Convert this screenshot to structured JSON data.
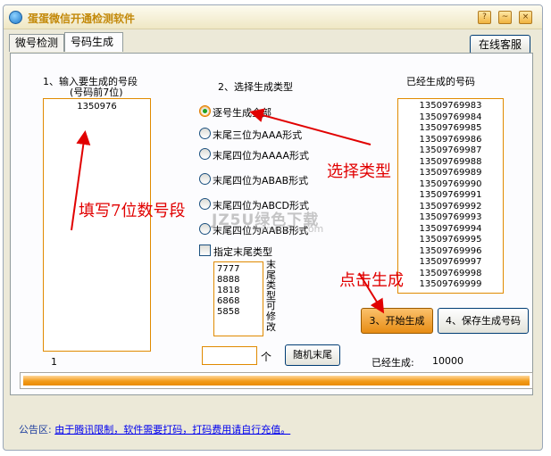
{
  "window": {
    "title": "蛋蛋微信开通检测软件",
    "title_color": "#c3890a",
    "buttons": [
      "?",
      "~",
      "×"
    ]
  },
  "tabs": [
    {
      "label": "微号检测",
      "active": false
    },
    {
      "label": "号码生成",
      "active": true
    }
  ],
  "online_service_label": "在线客服",
  "section1": {
    "heading": "1、输入要生成的号段",
    "subheading": "(号码前7位)",
    "value": "1350976",
    "count": "1"
  },
  "section2": {
    "heading": "2、选择生成类型",
    "options": [
      {
        "label": "逐号生成全部",
        "checked": true
      },
      {
        "label": "末尾三位为AAA形式",
        "checked": false
      },
      {
        "label": "末尾四位为AAAA形式",
        "checked": false
      },
      {
        "label": "末尾四位为ABAB形式",
        "checked": false
      },
      {
        "label": "末尾四位为ABCD形式",
        "checked": false
      },
      {
        "label": "末尾四位为AABB形式",
        "checked": false
      }
    ],
    "custom_label": "指定末尾类型",
    "custom_values": [
      "7777",
      "8888",
      "1818",
      "6868",
      "5858"
    ],
    "custom_note": "末尾类型可修改",
    "count_unit": "个",
    "random_button": "随机末尾"
  },
  "section3": {
    "heading": "已经生成的号码",
    "numbers": [
      "13509769983",
      "13509769984",
      "13509769985",
      "13509769986",
      "13509769987",
      "13509769988",
      "13509769989",
      "13509769990",
      "13509769991",
      "13509769992",
      "13509769993",
      "13509769994",
      "13509769995",
      "13509769996",
      "13509769997",
      "13509769998",
      "13509769999"
    ],
    "generated_label": "已经生成:",
    "generated_count": "10000"
  },
  "buttons": {
    "start": "3、开始生成",
    "save": "4、保存生成号码"
  },
  "progress": 1.0,
  "notice": {
    "prefix": "公告区:",
    "text": "由于腾讯限制，软件需要打码，打码费用请自行充值。"
  },
  "annotations": {
    "fill": "填写7位数号段",
    "type": "选择类型",
    "click": "点击生成",
    "color": "#e10000"
  },
  "watermark": {
    "main": "JZ5U绿色下载",
    "sub": "www.jz5u.com"
  },
  "colors": {
    "accent_orange": "#e08a00",
    "frame": "#ece9d8"
  }
}
